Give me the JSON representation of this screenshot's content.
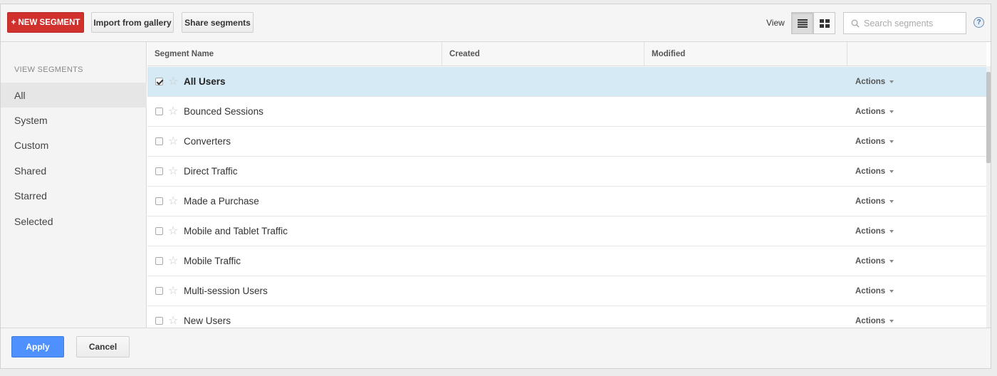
{
  "toolbar": {
    "new_segment_label": "+ NEW SEGMENT",
    "import_label": "Import from gallery",
    "share_label": "Share segments",
    "view_label": "View",
    "search_placeholder": "Search segments",
    "help_label": "?"
  },
  "sidebar": {
    "heading": "VIEW SEGMENTS",
    "items": [
      {
        "label": "All",
        "active": true
      },
      {
        "label": "System"
      },
      {
        "label": "Custom"
      },
      {
        "label": "Shared"
      },
      {
        "label": "Starred"
      },
      {
        "label": "Selected"
      }
    ]
  },
  "table": {
    "columns": [
      "Segment Name",
      "Created",
      "Modified"
    ],
    "action_label": "Actions",
    "rows": [
      {
        "name": "All Users",
        "checked": true
      },
      {
        "name": "Bounced Sessions",
        "checked": false
      },
      {
        "name": "Converters",
        "checked": false
      },
      {
        "name": "Direct Traffic",
        "checked": false
      },
      {
        "name": "Made a Purchase",
        "checked": false
      },
      {
        "name": "Mobile and Tablet Traffic",
        "checked": false
      },
      {
        "name": "Mobile Traffic",
        "checked": false
      },
      {
        "name": "Multi-session Users",
        "checked": false
      },
      {
        "name": "New Users",
        "checked": false
      }
    ]
  },
  "footer": {
    "apply_label": "Apply",
    "cancel_label": "Cancel"
  },
  "colors": {
    "new_segment_bg": "#d0312d",
    "apply_bg": "#4d90fe",
    "selected_row_bg": "#d6eaf5"
  }
}
